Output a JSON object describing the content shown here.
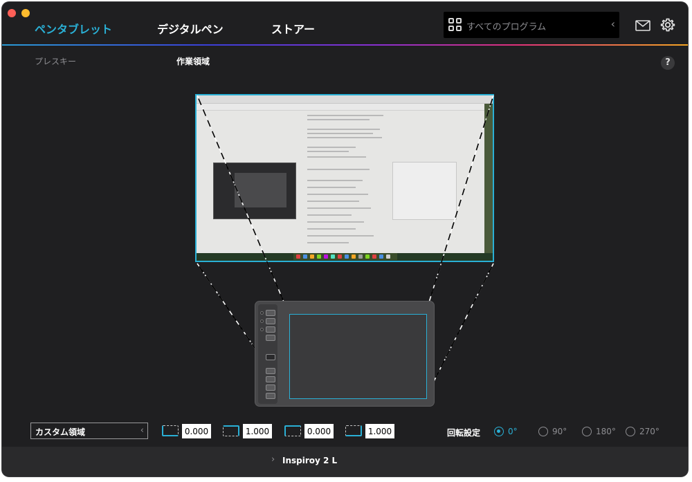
{
  "nav": {
    "tabs": [
      "ペンタブレット",
      "デジタルペン",
      "ストアー"
    ],
    "program_placeholder": "すべてのプログラム"
  },
  "subtabs": [
    "プレスキー",
    "作業領域"
  ],
  "help_label": "?",
  "area": {
    "preset": "カスタム領域",
    "values": [
      "0.000",
      "1.000",
      "0.000",
      "1.000"
    ]
  },
  "rotation": {
    "label": "回転設定",
    "options": [
      "0°",
      "90°",
      "180°",
      "270°"
    ],
    "selected": "0°"
  },
  "device": {
    "name": "Inspiroy 2 L"
  },
  "colors": {
    "accent": "#2ab0d6",
    "background": "#1f1f21"
  }
}
